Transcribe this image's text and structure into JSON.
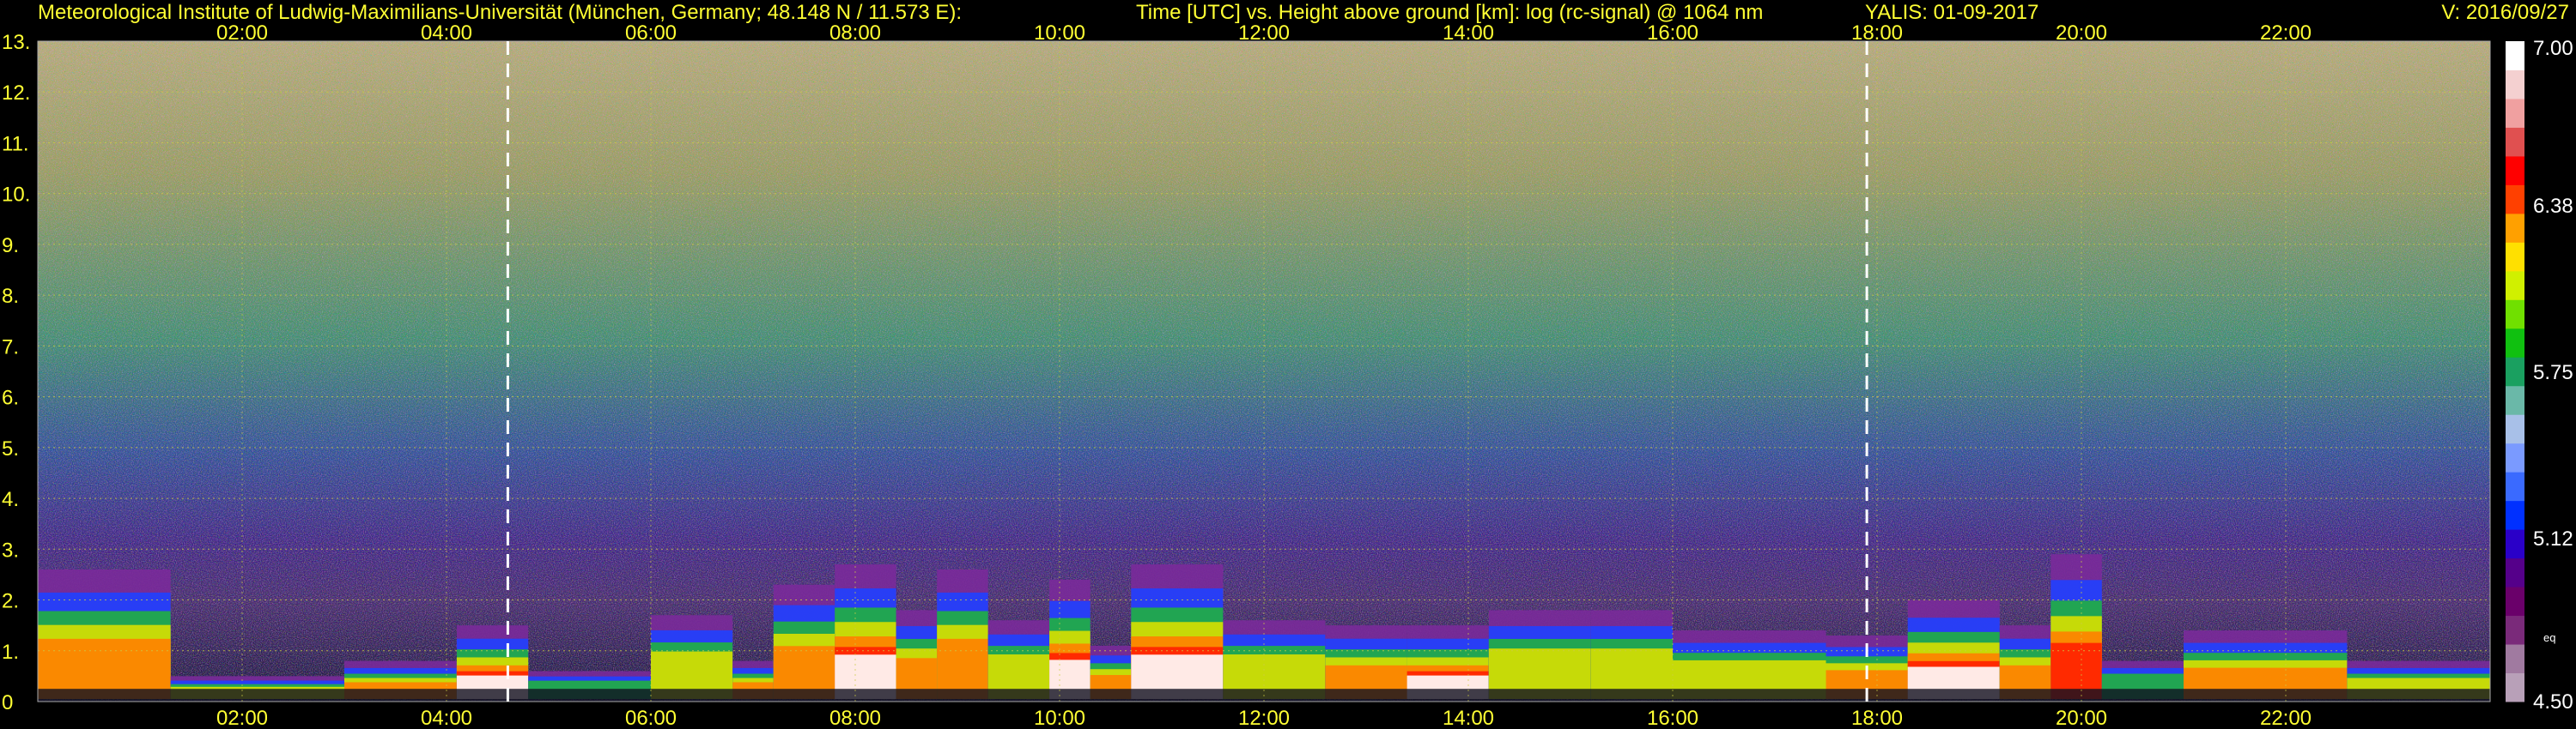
{
  "header": {
    "left": "Meteorological Institute of Ludwig-Maximilians-Universität (München, Germany; 48.148 N / 11.573 E):",
    "center": "Time [UTC] vs. Height above ground [km]: log (rc-signal) @ 1064 nm",
    "date": "YALIS: 01-09-2017",
    "version": "V: 2016/09/27"
  },
  "chart_data": {
    "type": "heatmap",
    "title": "Time [UTC] vs. Height above ground [km]: log (rc-signal) @ 1064 nm",
    "xlabel": "Time [UTC]",
    "ylabel": "Height above ground [km]",
    "xlim": [
      0,
      24
    ],
    "ylim": [
      0,
      13
    ],
    "x_ticks": [
      {
        "value": 2,
        "label": "02:00"
      },
      {
        "value": 4,
        "label": "04:00"
      },
      {
        "value": 6,
        "label": "06:00"
      },
      {
        "value": 8,
        "label": "08:00"
      },
      {
        "value": 10,
        "label": "10:00"
      },
      {
        "value": 12,
        "label": "12:00"
      },
      {
        "value": 14,
        "label": "14:00"
      },
      {
        "value": 16,
        "label": "16:00"
      },
      {
        "value": 18,
        "label": "18:00"
      },
      {
        "value": 20,
        "label": "20:00"
      },
      {
        "value": 22,
        "label": "22:00"
      }
    ],
    "y_ticks": [
      {
        "value": 0,
        "label": "0"
      },
      {
        "value": 1,
        "label": "1."
      },
      {
        "value": 2,
        "label": "2."
      },
      {
        "value": 3,
        "label": "3."
      },
      {
        "value": 4,
        "label": "4."
      },
      {
        "value": 5,
        "label": "5."
      },
      {
        "value": 6,
        "label": "6."
      },
      {
        "value": 7,
        "label": "7."
      },
      {
        "value": 8,
        "label": "8."
      },
      {
        "value": 9,
        "label": "9."
      },
      {
        "value": 10,
        "label": "10."
      },
      {
        "value": 11,
        "label": "11."
      },
      {
        "value": 12,
        "label": "12."
      },
      {
        "value": 13,
        "label": "13."
      }
    ],
    "grid": true,
    "dashed_markers_utc": [
      4.6,
      17.9
    ],
    "colorbar": {
      "min": 4.5,
      "max": 7.0,
      "ticks": [
        {
          "value": 7.0,
          "label": "7.00"
        },
        {
          "value": 6.38,
          "label": "6.38"
        },
        {
          "value": 5.75,
          "label": "5.75"
        },
        {
          "value": 5.12,
          "label": "5.12"
        },
        {
          "value": 4.5,
          "label": "4.50"
        }
      ],
      "note": "eq",
      "colors": [
        "#b8a0b8",
        "#a07aa0",
        "#7a2a7a",
        "#6a006a",
        "#55008a",
        "#2a00c8",
        "#0030ff",
        "#3a6aff",
        "#7a9aff",
        "#a8c0e8",
        "#6ab8a8",
        "#1aa060",
        "#10c010",
        "#70e000",
        "#d0f000",
        "#ffe000",
        "#ffa000",
        "#ff4000",
        "#ff0000",
        "#e05050",
        "#f0a0a0",
        "#f4d0d0",
        "#ffffff"
      ]
    },
    "layers": [
      {
        "start": 0.0,
        "end": 1.3,
        "top": 2.6,
        "intensity": 0.75
      },
      {
        "start": 1.3,
        "end": 3.0,
        "top": 0.5,
        "intensity": 0.6
      },
      {
        "start": 3.0,
        "end": 4.1,
        "top": 0.8,
        "intensity": 0.85
      },
      {
        "start": 4.1,
        "end": 4.8,
        "top": 1.5,
        "intensity": 0.95
      },
      {
        "start": 4.8,
        "end": 6.0,
        "top": 0.6,
        "intensity": 0.55
      },
      {
        "start": 6.0,
        "end": 6.8,
        "top": 1.7,
        "intensity": 0.7
      },
      {
        "start": 6.8,
        "end": 7.2,
        "top": 0.8,
        "intensity": 0.85
      },
      {
        "start": 7.2,
        "end": 7.8,
        "top": 2.3,
        "intensity": 0.8
      },
      {
        "start": 7.8,
        "end": 8.4,
        "top": 2.7,
        "intensity": 0.95
      },
      {
        "start": 8.4,
        "end": 8.8,
        "top": 1.8,
        "intensity": 0.75
      },
      {
        "start": 8.8,
        "end": 9.3,
        "top": 2.6,
        "intensity": 0.85
      },
      {
        "start": 9.3,
        "end": 9.9,
        "top": 1.6,
        "intensity": 0.7
      },
      {
        "start": 9.9,
        "end": 10.3,
        "top": 2.4,
        "intensity": 0.95
      },
      {
        "start": 10.3,
        "end": 10.7,
        "top": 1.1,
        "intensity": 0.75
      },
      {
        "start": 10.7,
        "end": 11.6,
        "top": 2.7,
        "intensity": 1.0
      },
      {
        "start": 11.6,
        "end": 12.6,
        "top": 1.6,
        "intensity": 0.7
      },
      {
        "start": 12.6,
        "end": 13.4,
        "top": 1.5,
        "intensity": 0.8
      },
      {
        "start": 13.4,
        "end": 14.2,
        "top": 1.5,
        "intensity": 0.95
      },
      {
        "start": 14.2,
        "end": 15.2,
        "top": 1.8,
        "intensity": 0.7
      },
      {
        "start": 15.2,
        "end": 16.0,
        "top": 1.8,
        "intensity": 0.7
      },
      {
        "start": 16.0,
        "end": 17.5,
        "top": 1.4,
        "intensity": 0.6
      },
      {
        "start": 17.5,
        "end": 18.3,
        "top": 1.3,
        "intensity": 0.75
      },
      {
        "start": 18.3,
        "end": 19.2,
        "top": 2.0,
        "intensity": 0.95
      },
      {
        "start": 19.2,
        "end": 19.7,
        "top": 1.5,
        "intensity": 0.85
      },
      {
        "start": 19.7,
        "end": 20.2,
        "top": 2.9,
        "intensity": 0.9
      },
      {
        "start": 20.2,
        "end": 21.0,
        "top": 0.8,
        "intensity": 0.55
      },
      {
        "start": 21.0,
        "end": 22.6,
        "top": 1.4,
        "intensity": 0.8
      },
      {
        "start": 22.6,
        "end": 24.0,
        "top": 0.8,
        "intensity": 0.6
      }
    ]
  }
}
